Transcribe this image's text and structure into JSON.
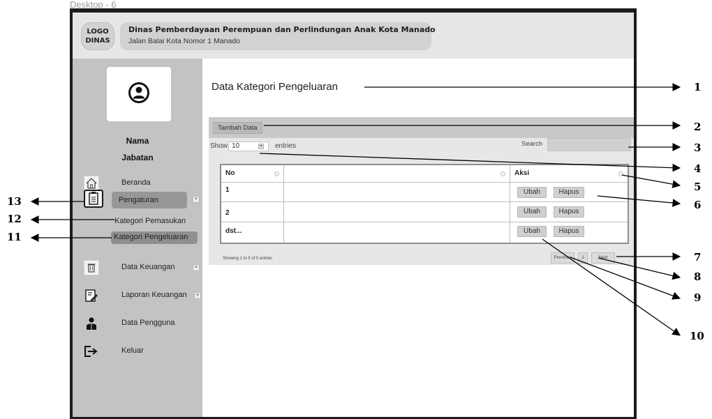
{
  "window": {
    "title": "Desktop - 6"
  },
  "header": {
    "logo_line1": "LOGO",
    "logo_line2": "DINAS",
    "org_name": "Dinas Pemberdayaan Perempuan dan Perlindungan Anak Kota Manado",
    "org_address": "Jalan Balai Kota Nomor 1 Manado"
  },
  "sidebar": {
    "user_name": "Nama",
    "user_role": "Jabatan",
    "items": {
      "beranda": "Beranda",
      "pengaturan": "Pengaturan",
      "kategori_pemasukan": "Kategori Pemasukan",
      "kategori_pengeluaran": "Kategori Pengeluaran",
      "data_keuangan": "Data Keuangan",
      "laporan_keuangan": "Laporan Keuangan",
      "data_pengguna": "Data Pengguna",
      "keluar": "Keluar"
    }
  },
  "main": {
    "title": "Data Kategori Pengeluaran",
    "add_button": "Tambah Data",
    "show_label": "Show",
    "show_value": "10",
    "entries_label": "entries",
    "search_label": "Search",
    "table": {
      "headers": [
        "No",
        "",
        "Aksi"
      ],
      "rows": [
        {
          "no": "1",
          "edit": "Ubah",
          "delete": "Hapus"
        },
        {
          "no": "2",
          "edit": "Ubah",
          "delete": "Hapus"
        },
        {
          "no": "dst...",
          "edit": "Ubah",
          "delete": "Hapus"
        }
      ]
    },
    "showing_text": "Showing 1 to 5 of 5 entries",
    "pagination": {
      "previous": "Previous",
      "page": "1",
      "next": "Next"
    }
  },
  "annotations": [
    "1",
    "2",
    "3",
    "4",
    "5",
    "6",
    "7",
    "8",
    "9",
    "10",
    "11",
    "12",
    "13"
  ]
}
